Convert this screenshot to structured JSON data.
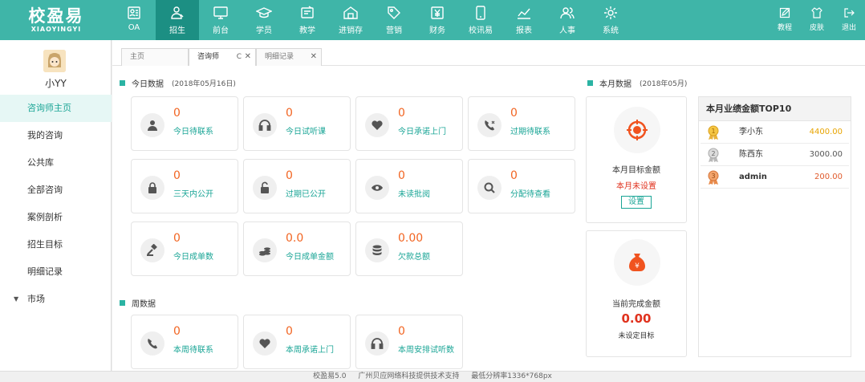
{
  "brand": {
    "name": "校盈易",
    "subname": "XIAOYINGYI"
  },
  "nav": [
    {
      "label": "OA",
      "icon": "oa-icon"
    },
    {
      "label": "招生",
      "icon": "enrollment-icon",
      "active": true
    },
    {
      "label": "前台",
      "icon": "monitor-icon"
    },
    {
      "label": "学员",
      "icon": "graduation-cap-icon"
    },
    {
      "label": "教学",
      "icon": "teaching-board-icon"
    },
    {
      "label": "进销存",
      "icon": "warehouse-icon"
    },
    {
      "label": "营销",
      "icon": "tag-icon"
    },
    {
      "label": "财务",
      "icon": "yen-icon"
    },
    {
      "label": "校讯易",
      "icon": "mobile-icon"
    },
    {
      "label": "报表",
      "icon": "chart-line-icon"
    },
    {
      "label": "人事",
      "icon": "people-icon"
    },
    {
      "label": "系统",
      "icon": "gear-icon"
    }
  ],
  "tools": [
    {
      "label": "教程",
      "icon": "edit-icon"
    },
    {
      "label": "皮肤",
      "icon": "shirt-icon"
    },
    {
      "label": "退出",
      "icon": "logout-icon"
    }
  ],
  "user": {
    "name": "小YY"
  },
  "sidebar": [
    {
      "label": "咨询师主页",
      "active": true
    },
    {
      "label": "我的咨询"
    },
    {
      "label": "公共库"
    },
    {
      "label": "全部咨询"
    },
    {
      "label": "案例剖析"
    },
    {
      "label": "招生目标"
    },
    {
      "label": "明细记录"
    },
    {
      "label": "市场",
      "caret": "▼"
    }
  ],
  "tabs": [
    {
      "label": "主页"
    },
    {
      "label": "咨询师",
      "refresh": "C",
      "close": "✕",
      "active": true
    },
    {
      "label": "明细记录",
      "close": "✕"
    }
  ],
  "today": {
    "title": "今日数据",
    "date": "(2018年05月16日)",
    "cards": [
      {
        "value": "0",
        "label": "今日待联系",
        "icon": "person-icon"
      },
      {
        "value": "0",
        "label": "今日试听课",
        "icon": "headphones-icon"
      },
      {
        "value": "0",
        "label": "今日承诺上门",
        "icon": "heart-icon"
      },
      {
        "value": "0",
        "label": "过期待联系",
        "icon": "phone-missed-icon"
      },
      {
        "value": "0",
        "label": "三天内公开",
        "icon": "lock-icon"
      },
      {
        "value": "0",
        "label": "过期已公开",
        "icon": "unlock-icon"
      },
      {
        "value": "0",
        "label": "未读批阅",
        "icon": "eye-icon"
      },
      {
        "value": "0",
        "label": "分配待查看",
        "icon": "search-icon"
      },
      {
        "value": "0",
        "label": "今日成单数",
        "icon": "gavel-icon"
      },
      {
        "value": "0.0",
        "label": "今日成单金额",
        "icon": "coins-icon"
      },
      {
        "value": "0.00",
        "label": "欠款总额",
        "icon": "database-icon"
      }
    ]
  },
  "week": {
    "title": "周数据",
    "cards": [
      {
        "value": "0",
        "label": "本周待联系",
        "icon": "phone-icon"
      },
      {
        "value": "0",
        "label": "本周承诺上门",
        "icon": "heart-icon"
      },
      {
        "value": "0",
        "label": "本周安排试听数",
        "icon": "headphones-icon"
      }
    ]
  },
  "month": {
    "title": "本月数据",
    "date": "(2018年05月)",
    "target_label": "本月目标金额",
    "target_status": "本月未设置",
    "set_button": "设置",
    "done_label": "当前完成金额",
    "done_value": "0.00",
    "done_note": "未设定目标"
  },
  "top10": {
    "title": "本月业绩金额TOP10",
    "rows": [
      {
        "rank": "1",
        "name": "李小东",
        "value": "4400.00",
        "color": "#e8a400"
      },
      {
        "rank": "2",
        "name": "陈西东",
        "value": "3000.00",
        "color": "#555555"
      },
      {
        "rank": "3",
        "name": "admin",
        "value": "200.00",
        "color": "#e05a2b"
      }
    ]
  },
  "footer": {
    "version": "校盈易5.0",
    "support": "广州贝应网络科技提供技术支持",
    "resolution": "最低分辨率1336*768px"
  },
  "colors": {
    "brand": "#3fb5a8",
    "nav_active": "#1c8f83",
    "accent": "#1aa596",
    "value": "#f26522",
    "alert": "#e0321e"
  }
}
